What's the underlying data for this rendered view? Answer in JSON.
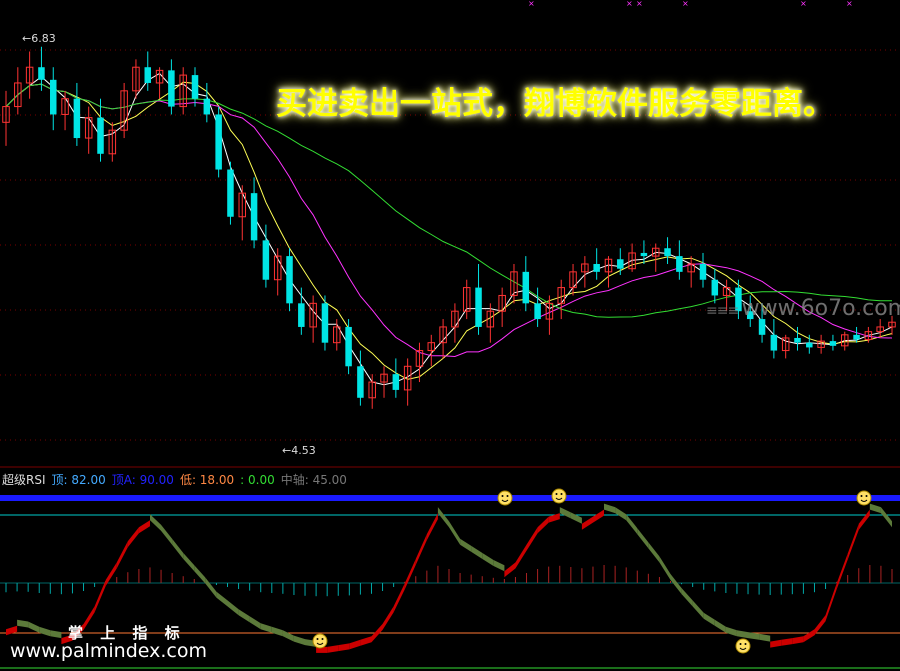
{
  "promo_text": "买进卖出一站式，翔博软件服务零距离。",
  "watermark_top": "www.6o7o.com",
  "watermark_bottom_cn": "掌 上 指 标",
  "watermark_bottom_url": "www.palmindex.com",
  "price_high_label": "6.83",
  "price_low_label": "4.53",
  "indicator": {
    "name": "超级RSI",
    "top_label": "顶: 82.00",
    "top_a_label": "顶A: 90.00",
    "low_label": "低: 18.00",
    "zero_label": ": 0.00",
    "mid_label": "中轴: 45.00"
  },
  "colors": {
    "up": "#ff3333",
    "down": "#00e5e5",
    "ma_white": "#ffffff",
    "ma_yellow": "#ffff55",
    "ma_magenta": "#ff33ff",
    "ma_green": "#33dd33",
    "rsi_up": "#cc0000",
    "rsi_down": "#5c7a3a",
    "top_line": "#1a1aff",
    "cyan_line": "#00cccc",
    "low_line": "#ff7733"
  },
  "chart_data": {
    "type": "candlestick",
    "price_range": [
      4.3,
      7.0
    ],
    "candles": [
      [
        6.35,
        6.55,
        6.2,
        6.45
      ],
      [
        6.45,
        6.7,
        6.4,
        6.6
      ],
      [
        6.6,
        6.8,
        6.5,
        6.7
      ],
      [
        6.7,
        6.83,
        6.55,
        6.62
      ],
      [
        6.62,
        6.7,
        6.3,
        6.4
      ],
      [
        6.4,
        6.55,
        6.3,
        6.5
      ],
      [
        6.5,
        6.6,
        6.2,
        6.25
      ],
      [
        6.25,
        6.45,
        6.15,
        6.38
      ],
      [
        6.38,
        6.5,
        6.1,
        6.15
      ],
      [
        6.15,
        6.35,
        6.1,
        6.3
      ],
      [
        6.3,
        6.6,
        6.25,
        6.55
      ],
      [
        6.55,
        6.75,
        6.5,
        6.7
      ],
      [
        6.7,
        6.8,
        6.55,
        6.6
      ],
      [
        6.6,
        6.7,
        6.5,
        6.68
      ],
      [
        6.68,
        6.75,
        6.4,
        6.45
      ],
      [
        6.45,
        6.7,
        6.4,
        6.65
      ],
      [
        6.65,
        6.7,
        6.45,
        6.5
      ],
      [
        6.5,
        6.6,
        6.35,
        6.4
      ],
      [
        6.4,
        6.45,
        6.0,
        6.05
      ],
      [
        6.05,
        6.1,
        5.7,
        5.75
      ],
      [
        5.75,
        5.95,
        5.6,
        5.9
      ],
      [
        5.9,
        6.0,
        5.55,
        5.6
      ],
      [
        5.6,
        5.7,
        5.3,
        5.35
      ],
      [
        5.35,
        5.55,
        5.25,
        5.5
      ],
      [
        5.5,
        5.55,
        5.15,
        5.2
      ],
      [
        5.2,
        5.3,
        5.0,
        5.05
      ],
      [
        5.05,
        5.25,
        4.95,
        5.2
      ],
      [
        5.2,
        5.25,
        4.9,
        4.95
      ],
      [
        4.95,
        5.1,
        4.9,
        5.05
      ],
      [
        5.05,
        5.1,
        4.75,
        4.8
      ],
      [
        4.8,
        4.9,
        4.55,
        4.6
      ],
      [
        4.6,
        4.75,
        4.53,
        4.7
      ],
      [
        4.7,
        4.8,
        4.6,
        4.75
      ],
      [
        4.75,
        4.85,
        4.6,
        4.65
      ],
      [
        4.65,
        4.85,
        4.55,
        4.8
      ],
      [
        4.8,
        4.95,
        4.7,
        4.9
      ],
      [
        4.9,
        5.0,
        4.8,
        4.95
      ],
      [
        4.95,
        5.1,
        4.85,
        5.05
      ],
      [
        5.05,
        5.2,
        4.95,
        5.15
      ],
      [
        5.15,
        5.35,
        5.1,
        5.3
      ],
      [
        5.3,
        5.45,
        5.0,
        5.05
      ],
      [
        5.05,
        5.2,
        4.95,
        5.15
      ],
      [
        5.15,
        5.3,
        5.05,
        5.25
      ],
      [
        5.25,
        5.45,
        5.2,
        5.4
      ],
      [
        5.4,
        5.5,
        5.15,
        5.2
      ],
      [
        5.2,
        5.3,
        5.05,
        5.1
      ],
      [
        5.1,
        5.25,
        5.0,
        5.2
      ],
      [
        5.2,
        5.35,
        5.1,
        5.3
      ],
      [
        5.3,
        5.45,
        5.25,
        5.4
      ],
      [
        5.4,
        5.5,
        5.3,
        5.45
      ],
      [
        5.45,
        5.55,
        5.35,
        5.4
      ],
      [
        5.4,
        5.5,
        5.3,
        5.48
      ],
      [
        5.48,
        5.55,
        5.38,
        5.42
      ],
      [
        5.42,
        5.58,
        5.4,
        5.52
      ],
      [
        5.52,
        5.6,
        5.45,
        5.5
      ],
      [
        5.5,
        5.58,
        5.4,
        5.55
      ],
      [
        5.55,
        5.62,
        5.45,
        5.5
      ],
      [
        5.5,
        5.6,
        5.35,
        5.4
      ],
      [
        5.4,
        5.5,
        5.3,
        5.45
      ],
      [
        5.45,
        5.52,
        5.3,
        5.35
      ],
      [
        5.35,
        5.42,
        5.2,
        5.25
      ],
      [
        5.25,
        5.35,
        5.15,
        5.3
      ],
      [
        5.3,
        5.35,
        5.1,
        5.15
      ],
      [
        5.15,
        5.25,
        5.05,
        5.1
      ],
      [
        5.1,
        5.2,
        4.95,
        5.0
      ],
      [
        5.0,
        5.1,
        4.85,
        4.9
      ],
      [
        4.9,
        5.0,
        4.85,
        4.98
      ],
      [
        4.98,
        5.05,
        4.9,
        4.95
      ],
      [
        4.95,
        5.0,
        4.88,
        4.92
      ],
      [
        4.92,
        5.0,
        4.88,
        4.96
      ],
      [
        4.96,
        5.0,
        4.9,
        4.93
      ],
      [
        4.93,
        5.02,
        4.9,
        5.0
      ],
      [
        5.0,
        5.05,
        4.95,
        4.97
      ],
      [
        4.97,
        5.05,
        4.95,
        5.02
      ],
      [
        5.02,
        5.1,
        4.98,
        5.05
      ],
      [
        5.05,
        5.12,
        5.0,
        5.08
      ]
    ],
    "rsi_levels": {
      "top": 82.0,
      "topA": 90.0,
      "low": 18.0,
      "zero": 0.0,
      "mid": 45.0
    },
    "rsi": [
      22,
      24,
      23,
      20,
      18,
      17,
      19,
      25,
      35,
      50,
      60,
      72,
      80,
      84,
      78,
      70,
      62,
      55,
      48,
      40,
      35,
      30,
      26,
      22,
      20,
      18,
      15,
      13,
      12,
      12,
      13,
      14,
      16,
      18,
      25,
      35,
      48,
      62,
      76,
      88,
      80,
      70,
      66,
      62,
      58,
      55,
      60,
      70,
      80,
      86,
      88,
      85,
      82,
      86,
      90,
      88,
      84,
      76,
      68,
      60,
      50,
      42,
      35,
      28,
      24,
      20,
      18,
      17,
      16,
      15,
      16,
      17,
      18,
      22,
      30,
      48,
      65,
      82,
      90,
      88,
      80
    ]
  }
}
